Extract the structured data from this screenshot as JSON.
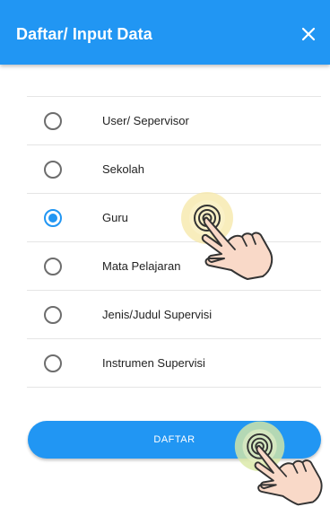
{
  "header": {
    "title": "Daftar/ Input Data",
    "close_icon": "close-icon"
  },
  "options": [
    {
      "label": "User/ Sepervisor",
      "checked": false
    },
    {
      "label": "Sekolah",
      "checked": false
    },
    {
      "label": "Guru",
      "checked": true
    },
    {
      "label": "Mata Pelajaran",
      "checked": false
    },
    {
      "label": "Jenis/Judul Supervisi",
      "checked": false
    },
    {
      "label": "Instrumen Supervisi",
      "checked": false
    }
  ],
  "submit": {
    "label": "DAFTAR"
  },
  "colors": {
    "primary": "#2196f3",
    "radio_unchecked": "#6d6d6d",
    "divider": "#e5e5e5"
  },
  "overlays": [
    "tap-hand-icon",
    "tap-hand-icon"
  ]
}
